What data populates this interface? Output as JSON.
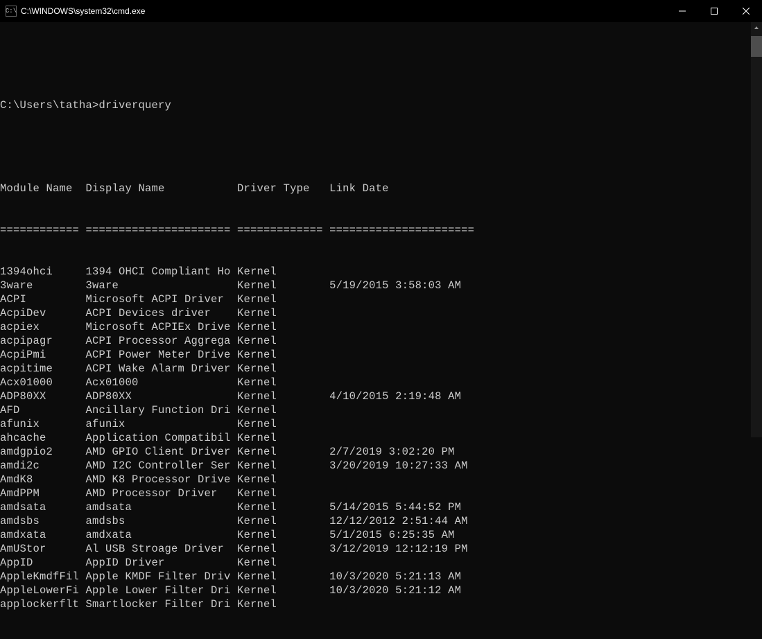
{
  "titlebar": {
    "title": "C:\\WINDOWS\\system32\\cmd.exe"
  },
  "prompt": "C:\\Users\\tatha>driverquery",
  "headers": {
    "module": "Module Name",
    "display": "Display Name",
    "driver_type": "Driver Type",
    "link_date": "Link Date"
  },
  "separators": {
    "module": "============",
    "display": "======================",
    "driver_type": "=============",
    "link_date": "======================"
  },
  "rows": [
    {
      "module": "1394ohci",
      "display": "1394 OHCI Compliant Ho",
      "driver_type": "Kernel",
      "link_date": ""
    },
    {
      "module": "3ware",
      "display": "3ware",
      "driver_type": "Kernel",
      "link_date": "5/19/2015 3:58:03 AM"
    },
    {
      "module": "ACPI",
      "display": "Microsoft ACPI Driver",
      "driver_type": "Kernel",
      "link_date": ""
    },
    {
      "module": "AcpiDev",
      "display": "ACPI Devices driver",
      "driver_type": "Kernel",
      "link_date": ""
    },
    {
      "module": "acpiex",
      "display": "Microsoft ACPIEx Drive",
      "driver_type": "Kernel",
      "link_date": ""
    },
    {
      "module": "acpipagr",
      "display": "ACPI Processor Aggrega",
      "driver_type": "Kernel",
      "link_date": ""
    },
    {
      "module": "AcpiPmi",
      "display": "ACPI Power Meter Drive",
      "driver_type": "Kernel",
      "link_date": ""
    },
    {
      "module": "acpitime",
      "display": "ACPI Wake Alarm Driver",
      "driver_type": "Kernel",
      "link_date": ""
    },
    {
      "module": "Acx01000",
      "display": "Acx01000",
      "driver_type": "Kernel",
      "link_date": ""
    },
    {
      "module": "ADP80XX",
      "display": "ADP80XX",
      "driver_type": "Kernel",
      "link_date": "4/10/2015 2:19:48 AM"
    },
    {
      "module": "AFD",
      "display": "Ancillary Function Dri",
      "driver_type": "Kernel",
      "link_date": ""
    },
    {
      "module": "afunix",
      "display": "afunix",
      "driver_type": "Kernel",
      "link_date": ""
    },
    {
      "module": "ahcache",
      "display": "Application Compatibil",
      "driver_type": "Kernel",
      "link_date": ""
    },
    {
      "module": "amdgpio2",
      "display": "AMD GPIO Client Driver",
      "driver_type": "Kernel",
      "link_date": "2/7/2019 3:02:20 PM"
    },
    {
      "module": "amdi2c",
      "display": "AMD I2C Controller Ser",
      "driver_type": "Kernel",
      "link_date": "3/20/2019 10:27:33 AM"
    },
    {
      "module": "AmdK8",
      "display": "AMD K8 Processor Drive",
      "driver_type": "Kernel",
      "link_date": ""
    },
    {
      "module": "AmdPPM",
      "display": "AMD Processor Driver",
      "driver_type": "Kernel",
      "link_date": ""
    },
    {
      "module": "amdsata",
      "display": "amdsata",
      "driver_type": "Kernel",
      "link_date": "5/14/2015 5:44:52 PM"
    },
    {
      "module": "amdsbs",
      "display": "amdsbs",
      "driver_type": "Kernel",
      "link_date": "12/12/2012 2:51:44 AM"
    },
    {
      "module": "amdxata",
      "display": "amdxata",
      "driver_type": "Kernel",
      "link_date": "5/1/2015 6:25:35 AM"
    },
    {
      "module": "AmUStor",
      "display": "Al USB Stroage Driver",
      "driver_type": "Kernel",
      "link_date": "3/12/2019 12:12:19 PM"
    },
    {
      "module": "AppID",
      "display": "AppID Driver",
      "driver_type": "Kernel",
      "link_date": ""
    },
    {
      "module": "AppleKmdfFil",
      "display": "Apple KMDF Filter Driv",
      "driver_type": "Kernel",
      "link_date": "10/3/2020 5:21:13 AM"
    },
    {
      "module": "AppleLowerFi",
      "display": "Apple Lower Filter Dri",
      "driver_type": "Kernel",
      "link_date": "10/3/2020 5:21:12 AM"
    },
    {
      "module": "applockerflt",
      "display": "Smartlocker Filter Dri",
      "driver_type": "Kernel",
      "link_date": ""
    }
  ]
}
